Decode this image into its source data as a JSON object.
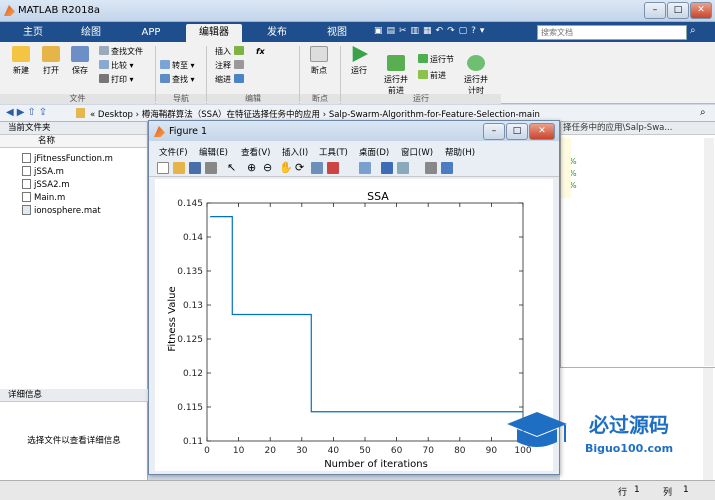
{
  "window": {
    "title": "MATLAB R2018a"
  },
  "tabs": [
    "主页",
    "绘图",
    "APP",
    "编辑器",
    "发布",
    "视图"
  ],
  "active_tab": "编辑器",
  "search": {
    "placeholder": "搜索文档"
  },
  "ribbon": {
    "file": {
      "new": "新建",
      "open": "打开",
      "save": "保存",
      "find_files": "查找文件",
      "compare": "比较",
      "print": "打印",
      "group": "文件"
    },
    "navigate": {
      "goto": "转至",
      "find": "查找",
      "group": "导航"
    },
    "edit": {
      "insert": "插入",
      "fx": "fx",
      "comment": "注释",
      "indent": "缩进",
      "group": "编辑"
    },
    "breakpoints": {
      "label": "断点",
      "group": "断点"
    },
    "run": {
      "run": "运行",
      "run_advance": "运行并\n前进",
      "run_section": "运行节",
      "advance": "前进",
      "run_time": "运行并\n计时",
      "group": "运行"
    }
  },
  "address": {
    "path": "«  Desktop  ›  樽海鞘群算法（SSA）在特征选择任务中的应用  ›  Salp-Swarm-Algorithm-for-Feature-Selection-main",
    "right_snip": "择任务中的应用\\Salp-Swa..."
  },
  "current_folder": {
    "title": "当前文件夹",
    "column": "名称",
    "files": [
      "jFitnessFunction.m",
      "jSSA.m",
      "jSSA2.m",
      "Main.m",
      "ionosphere.mat"
    ]
  },
  "details": {
    "title": "详细信息",
    "text": "选择文件以查看详细信息"
  },
  "figure": {
    "title": "Figure 1",
    "menu": [
      "文件(F)",
      "编辑(E)",
      "查看(V)",
      "插入(I)",
      "工具(T)",
      "桌面(D)",
      "窗口(W)",
      "帮助(H)"
    ]
  },
  "chart_data": {
    "type": "line",
    "title": "SSA",
    "xlabel": "Number of iterations",
    "ylabel": "Fitness Value",
    "xlim": [
      0,
      100
    ],
    "ylim": [
      0.11,
      0.145
    ],
    "xticks": [
      0,
      10,
      20,
      30,
      40,
      50,
      60,
      70,
      80,
      90,
      100
    ],
    "yticks": [
      0.11,
      0.115,
      0.12,
      0.125,
      0.13,
      0.135,
      0.14,
      0.145
    ],
    "x": [
      1,
      2,
      3,
      4,
      5,
      6,
      7,
      8,
      9,
      10,
      15,
      20,
      25,
      30,
      32,
      33,
      40,
      50,
      60,
      70,
      80,
      90,
      100
    ],
    "values": [
      0.143,
      0.143,
      0.143,
      0.143,
      0.143,
      0.143,
      0.143,
      0.1286,
      0.1286,
      0.1286,
      0.1286,
      0.1286,
      0.1286,
      0.1286,
      0.1286,
      0.1143,
      0.1143,
      0.1143,
      0.1143,
      0.1143,
      0.1143,
      0.1143,
      0.1143
    ],
    "grid": false,
    "line_color": "#0072BD"
  },
  "editor": {
    "tag": "%"
  },
  "status": {
    "row_label": "行",
    "row": "1",
    "col_label": "列",
    "col": "1"
  },
  "watermark": {
    "name": "必过源码",
    "url": "Biguo100.com"
  }
}
